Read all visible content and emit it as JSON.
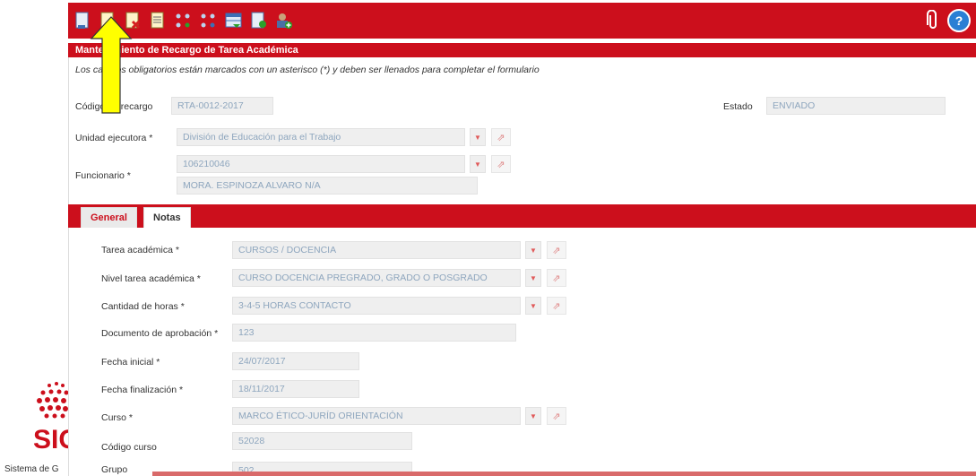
{
  "toolbar": {
    "icons": [
      "new-document-icon",
      "approve-document-icon",
      "delete-document-icon",
      "document-list-icon",
      "expand-nodes-icon",
      "collapse-nodes-icon",
      "table-icon",
      "user-document-icon",
      "add-user-icon"
    ],
    "right_icons": [
      "attachment-icon",
      "help-icon"
    ],
    "help_label": "?"
  },
  "form": {
    "title": "Mantenimiento de Recargo de Tarea Académica",
    "note": "Los campos obligatorios están marcados con un asterisco (*) y deben ser llenados para completar el formulario",
    "codigo_label": "Código de recargo",
    "codigo_value": "RTA-0012-2017",
    "estado_label": "Estado",
    "estado_value": "ENVIADO",
    "unidad_label": "Unidad ejecutora *",
    "unidad_value": "División de Educación para el Trabajo",
    "funcionario_label": "Funcionario *",
    "funcionario_id": "106210046",
    "funcionario_name": "MORA. ESPINOZA ALVARO N/A"
  },
  "tabs": [
    {
      "label": "General",
      "active": false
    },
    {
      "label": "Notas",
      "active": true
    }
  ],
  "general": {
    "tarea_label": "Tarea académica *",
    "tarea_value": "CURSOS / DOCENCIA",
    "nivel_label": "Nivel tarea académica *",
    "nivel_value": "CURSO DOCENCIA PREGRADO, GRADO O POSGRADO",
    "horas_label": "Cantidad de horas *",
    "horas_value": "3-4-5 HORAS CONTACTO",
    "documento_label": "Documento de aprobación *",
    "documento_value": "123",
    "fecha_ini_label": "Fecha inicial *",
    "fecha_ini_value": "24/07/2017",
    "fecha_fin_label": "Fecha finalización *",
    "fecha_fin_value": "18/11/2017",
    "curso_label": "Curso *",
    "curso_value": "MARCO ÉTICO-JURÍD ORIENTACIÓN",
    "codigo_curso_label": "Código curso",
    "codigo_curso_value": "52028",
    "grupo_label": "Grupo",
    "grupo_value": "502"
  },
  "dropdown_glyph": "▼",
  "link_glyph": "⇗",
  "logo": {
    "text": "SIG",
    "caption": "Sistema de G"
  },
  "colors": {
    "brand_red": "#cc0f1c",
    "arrow_yellow": "#ffff00"
  }
}
